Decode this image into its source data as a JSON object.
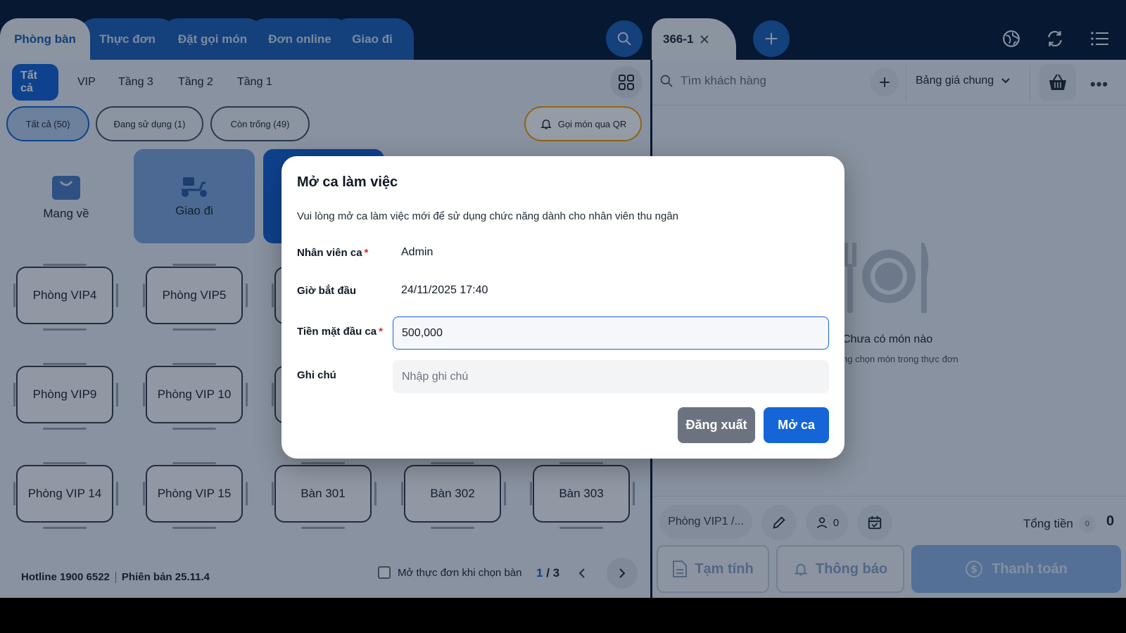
{
  "header": {
    "tabs": [
      {
        "label": "Phòng bàn",
        "active": true
      },
      {
        "label": "Thực đơn",
        "active": false
      },
      {
        "label": "Đặt gọi món",
        "active": false
      },
      {
        "label": "Đơn online",
        "active": false
      },
      {
        "label": "Giao đi",
        "active": false
      }
    ],
    "order_tab": {
      "label": "366-1"
    },
    "icons": [
      "search-icon",
      "plus-icon",
      "globe-icon",
      "refresh-icon",
      "list-icon"
    ]
  },
  "left": {
    "floor_tabs": [
      {
        "label": "Tất cả",
        "active": true
      },
      {
        "label": "VIP",
        "active": false
      },
      {
        "label": "Tầng 3",
        "active": false
      },
      {
        "label": "Tầng 2",
        "active": false
      },
      {
        "label": "Tầng 1",
        "active": false
      }
    ],
    "filters": [
      {
        "label": "Tất cả (50)",
        "active": true
      },
      {
        "label": "Đang sử dụng (1)",
        "active": false
      },
      {
        "label": "Còn trống (49)",
        "active": false
      }
    ],
    "qr_label": "Gọi món qua QR",
    "special": {
      "takeaway": "Mang về",
      "delivery": "Giao đi"
    },
    "tables": [
      "Phòng VIP4",
      "Phòng VIP5",
      "",
      "Phòng VIP9",
      "Phòng VIP 10",
      "",
      "Phòng VIP 14",
      "Phòng VIP 15",
      "Bàn 301",
      "Bàn 302",
      "Bàn 303"
    ],
    "footer": {
      "hotline": "Hotline 1900 6522",
      "version": "Phiên bản 25.11.4",
      "open_menu_label": "Mở thực đơn khi chọn bàn",
      "page_current": "1",
      "page_total": "/ 3"
    }
  },
  "right": {
    "customer_placeholder": "Tìm khách hàng",
    "pricebook": "Bảng giá chung",
    "empty_title": "Chưa có món nào",
    "empty_sub": "ng chọn món trong thực đơn",
    "room": "Phòng VIP1 /...",
    "guests": "0",
    "total_label": "Tổng tiền",
    "total_count": "0",
    "total_value": "0",
    "buttons": {
      "draft": "Tạm tính",
      "notify": "Thông báo",
      "pay": "Thanh toán"
    }
  },
  "modal": {
    "title": "Mở ca làm việc",
    "description": "Vui lòng mở ca làm việc mới để sử dụng chức năng dành cho nhân viên thu ngân",
    "fields": {
      "staff_label": "Nhân viên ca",
      "staff_value": "Admin",
      "start_label": "Giờ bắt đầu",
      "start_value": "24/11/2025 17:40",
      "cash_label": "Tiền mặt đầu ca",
      "cash_value": "500,000",
      "note_label": "Ghi chú",
      "note_placeholder": "Nhập ghi chú"
    },
    "buttons": {
      "logout": "Đăng xuất",
      "open": "Mở ca"
    }
  },
  "colors": {
    "primary": "#1565d8",
    "navy": "#0a1d3a",
    "required": "#dc2626",
    "qr_border": "#f59e0b"
  }
}
